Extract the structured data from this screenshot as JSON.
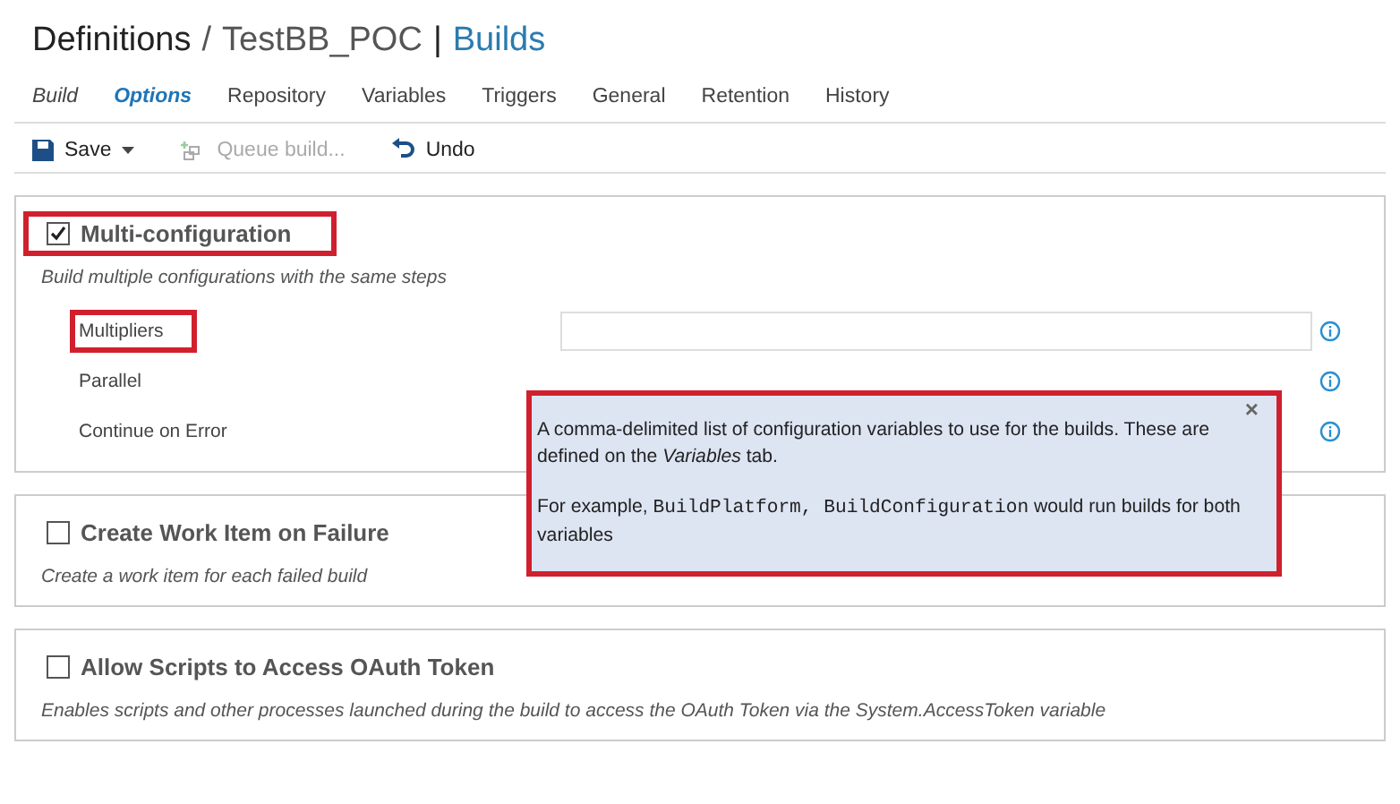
{
  "breadcrumb": {
    "root": "Definitions",
    "separator": "/",
    "project": "TestBB_POC",
    "divider": "|",
    "current": "Builds"
  },
  "tabs": [
    {
      "label": "Build",
      "selected": false,
      "italic": true
    },
    {
      "label": "Options",
      "selected": true,
      "italic": true
    },
    {
      "label": "Repository",
      "selected": false,
      "italic": false
    },
    {
      "label": "Variables",
      "selected": false,
      "italic": false
    },
    {
      "label": "Triggers",
      "selected": false,
      "italic": false
    },
    {
      "label": "General",
      "selected": false,
      "italic": false
    },
    {
      "label": "Retention",
      "selected": false,
      "italic": false
    },
    {
      "label": "History",
      "selected": false,
      "italic": false
    }
  ],
  "toolbar": [
    {
      "kind": "save",
      "label": "Save",
      "disabled": false
    },
    {
      "kind": "queue",
      "label": "Queue build...",
      "disabled": true
    },
    {
      "kind": "undo",
      "label": "Undo",
      "disabled": false
    }
  ],
  "sections": [
    {
      "title": "Multi-configuration",
      "checked": true,
      "highlighted": true,
      "description": "Build multiple configurations with the same steps",
      "fields": [
        {
          "label": "Multipliers",
          "highlighted": true
        },
        {
          "label": "Parallel",
          "highlighted": false
        },
        {
          "label": "Continue on Error",
          "highlighted": false
        }
      ]
    },
    {
      "title": "Create Work Item on Failure",
      "checked": false,
      "highlighted": false,
      "description": "Create a work item for each failed build"
    },
    {
      "title": "Allow Scripts to Access OAuth Token",
      "checked": false,
      "highlighted": false,
      "description": "Enables scripts and other processes launched during the build to access the OAuth Token via the System.AccessToken variable"
    }
  ],
  "tooltip": {
    "close": "×",
    "paragraph": "A comma-delimited list of configuration variables to use for the builds. These are defined on the *Variables* tab.",
    "example": [
      {
        "kind": "text",
        "text": "For example, "
      },
      {
        "kind": "code",
        "text": "BuildPlatform, BuildConfiguration"
      },
      {
        "kind": "text",
        "text": " would run builds for both variables"
      }
    ]
  }
}
